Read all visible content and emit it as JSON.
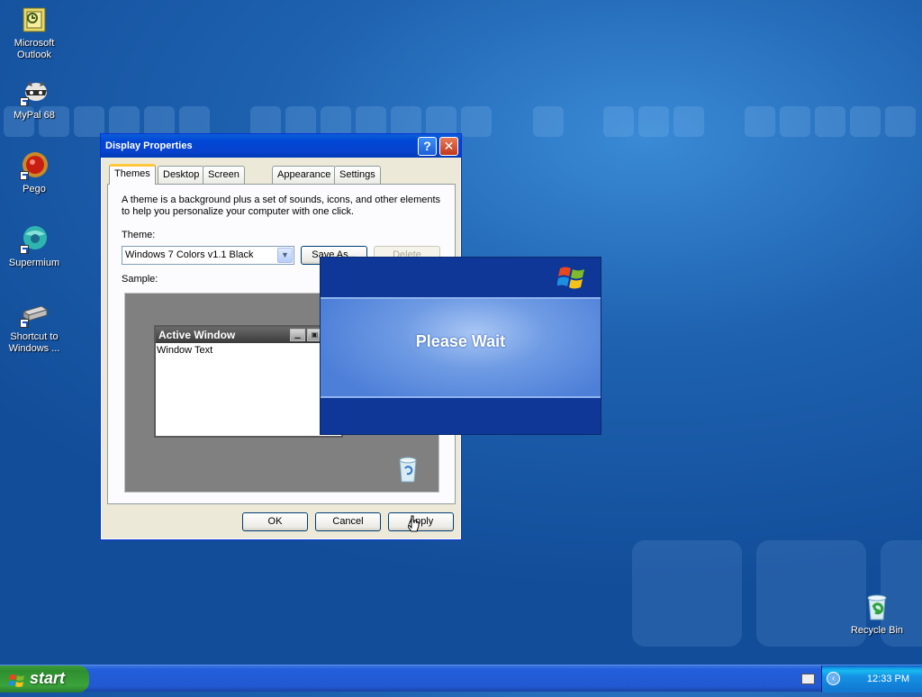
{
  "desktop": {
    "icons": [
      {
        "label_line1": "Microsoft",
        "label_line2": "Outlook",
        "icon": "outlook-icon"
      },
      {
        "label_line1": "MyPal 68",
        "label_line2": "",
        "icon": "mypal-icon"
      },
      {
        "label_line1": "Pego",
        "label_line2": "",
        "icon": "pego-icon"
      },
      {
        "label_line1": "Supermium",
        "label_line2": "",
        "icon": "supermium-icon"
      },
      {
        "label_line1": "Shortcut to",
        "label_line2": "Windows ...",
        "icon": "windows-shortcut-icon"
      },
      {
        "label_line1": "Recycle Bin",
        "label_line2": "",
        "icon": "recycle-bin-icon"
      }
    ]
  },
  "dialog": {
    "title": "Display Properties",
    "help_glyph": "?",
    "close_glyph": "✕",
    "tabs": [
      "Themes",
      "Desktop",
      "Screen Saver",
      "Appearance",
      "Settings"
    ],
    "active_tab": "Themes",
    "description": "A theme is a background plus a set of sounds, icons, and other elements to help you personalize your computer with one click.",
    "theme_label": "Theme:",
    "theme_value": "Windows 7 Colors v1.1 Black",
    "save_as": "Save As...",
    "delete": "Delete",
    "sample_label": "Sample:",
    "sample_window_title": "Active Window",
    "sample_window_text": "Window Text",
    "ok": "OK",
    "cancel": "Cancel",
    "apply": "Apply"
  },
  "splash": {
    "text": "Please Wait"
  },
  "taskbar": {
    "start_label": "start",
    "clock": "12:33 PM",
    "tray_chevron": "‹"
  },
  "colors": {
    "desktop": "#1e62b0",
    "titlebar": "#0046d5",
    "start_button": "#3aa33a",
    "splash": "#0e3798"
  }
}
